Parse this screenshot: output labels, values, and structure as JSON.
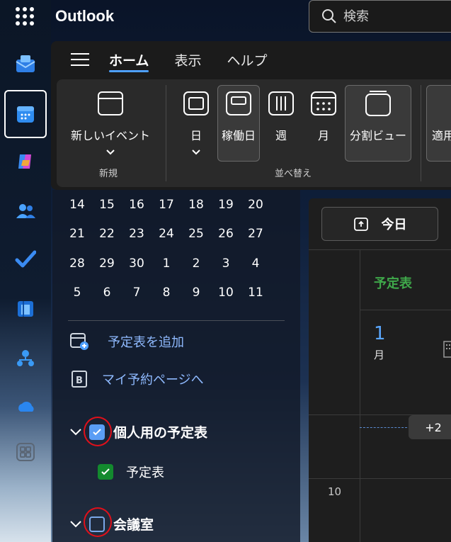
{
  "app": {
    "title": "Outlook"
  },
  "search": {
    "placeholder": "検索"
  },
  "rail": {
    "items": [
      {
        "name": "mail-icon",
        "color": "#2f8cf0"
      },
      {
        "name": "calendar-icon",
        "color": "#2f8cf0"
      },
      {
        "name": "copilot-icon",
        "color": "#c046d8"
      },
      {
        "name": "people-icon",
        "color": "#2f8cf0"
      },
      {
        "name": "todo-icon",
        "color": "#2f8cf0"
      },
      {
        "name": "word-icon",
        "color": "#2f8cf0"
      },
      {
        "name": "org-icon",
        "color": "#2f8cf0"
      },
      {
        "name": "onedrive-icon",
        "color": "#2f8cf0"
      },
      {
        "name": "more-apps-icon",
        "color": "#cfd6df"
      }
    ]
  },
  "tabs": [
    {
      "label": "ホーム",
      "active": true
    },
    {
      "label": "表示",
      "active": false
    },
    {
      "label": "ヘルプ",
      "active": false
    }
  ],
  "ribbon": {
    "new_event": "新しいイベント",
    "group_new": "新規",
    "day": "日",
    "workweek": "稼働日",
    "week": "週",
    "month": "月",
    "split_view": "分割ビュー",
    "apply": "適用",
    "group_arrange": "並べ替え"
  },
  "mini_calendar": {
    "rows": [
      [
        "14",
        "15",
        "16",
        "17",
        "18",
        "19",
        "20"
      ],
      [
        "21",
        "22",
        "23",
        "24",
        "25",
        "26",
        "27"
      ],
      [
        "28",
        "29",
        "30",
        "1",
        "2",
        "3",
        "4"
      ],
      [
        "5",
        "6",
        "7",
        "8",
        "9",
        "10",
        "11"
      ]
    ]
  },
  "left_pane": {
    "add_calendar": "予定表を追加",
    "booking_page": "マイ予約ページへ",
    "group_personal": "個人用の予定表",
    "calendar_item": "予定表",
    "group_rooms": "会議室"
  },
  "calendar_view": {
    "today": "今日",
    "calendar_name": "予定表",
    "day_number": "1",
    "day_unit": "月",
    "more_count": "+2",
    "hour_label": "10"
  },
  "colors": {
    "accent": "#4ea0ff",
    "calendar_green": "#3fa84a",
    "annotation_red": "#e0101a"
  }
}
